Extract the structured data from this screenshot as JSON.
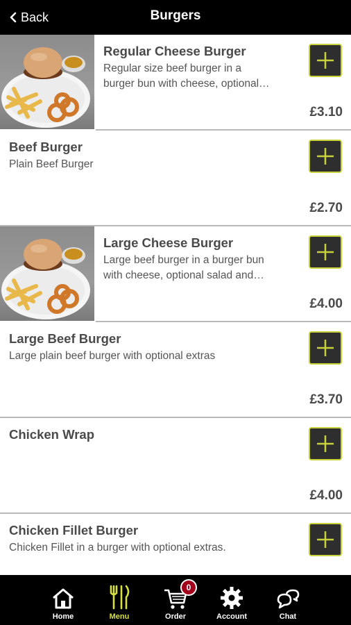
{
  "header": {
    "back_label": "Back",
    "title": "Burgers"
  },
  "items": [
    {
      "name": "Regular Cheese Burger",
      "desc1": "Regular size beef burger in a",
      "desc2": "burger bun with cheese, optional…",
      "price": "£3.10",
      "image": "burger-and-chips-photo"
    },
    {
      "name": "Beef Burger",
      "desc1": "Plain Beef Burger",
      "price": "£2.70"
    },
    {
      "name": "Large Cheese Burger",
      "desc1": "Large beef burger in a burger bun",
      "desc2": "with cheese, optional salad and…",
      "price": "£4.00",
      "image": "burger-and-chips-photo"
    },
    {
      "name": "Large Beef Burger",
      "desc1": "Large plain beef burger with optional extras",
      "price": "£3.70"
    },
    {
      "name": "Chicken Wrap",
      "price": "£4.00"
    },
    {
      "name": "Chicken Fillet Burger",
      "desc1": "Chicken Fillet in a burger with optional extras.",
      "price": ""
    }
  ],
  "tabbar": {
    "tabs": [
      {
        "label": "Home",
        "icon": "house-icon"
      },
      {
        "label": "Menu",
        "icon": "fork-knife-icon",
        "active": true
      },
      {
        "label": "Order",
        "icon": "cart-icon",
        "badge": "0"
      },
      {
        "label": "Account",
        "icon": "gear-icon"
      },
      {
        "label": "Chat",
        "icon": "chat-bubbles-icon"
      }
    ]
  },
  "colors": {
    "header_bg": "#000000",
    "add_button_bg": "#2e2e2e",
    "add_button_border": "#c7d13a",
    "active_tab": "#d8e03e",
    "badge_bg": "#a3001b"
  }
}
